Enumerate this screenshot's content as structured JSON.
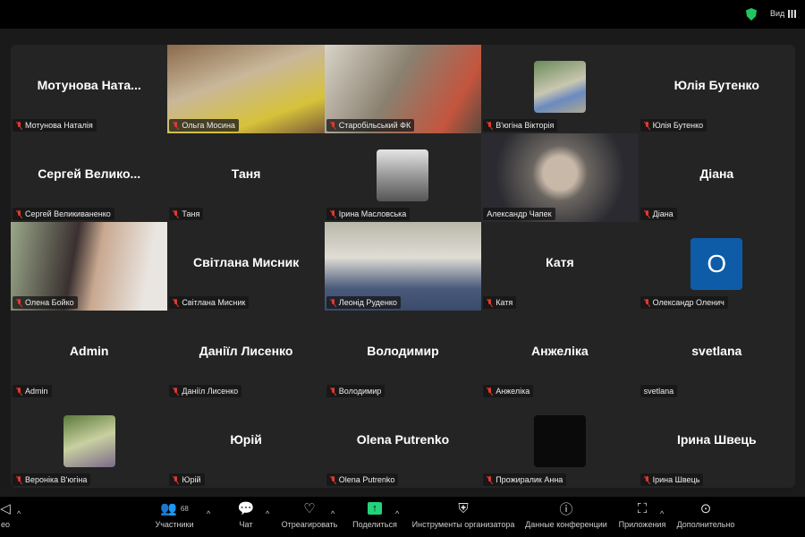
{
  "topbar": {
    "view_label": "Вид"
  },
  "tiles": [
    {
      "kind": "name",
      "big": "Мотунова  Ната...",
      "label": "Мотунова Наталія",
      "muted": true
    },
    {
      "kind": "video",
      "label": "Ольга Мосина",
      "muted": true,
      "bg": "linear-gradient(160deg,#8a6a4a,#c9b79a 40%,#d6c23a 75%,#7a5a3a)"
    },
    {
      "kind": "video",
      "label": "Старобільський ФК",
      "muted": true,
      "bg": "linear-gradient(120deg,#d9d4c8,#8a8070 45%,#c4553e 80%,#5a4a40)"
    },
    {
      "kind": "avatar",
      "label": "В'югіна Вікторія",
      "muted": true,
      "bg": "linear-gradient(160deg,#6a8a5a,#c9c7b0 50%,#6b8ac0 70%,#b0a890)"
    },
    {
      "kind": "name",
      "big": "Юлія Бутенко",
      "label": "Юлія Бутенко",
      "muted": true
    },
    {
      "kind": "name",
      "big": "Сергей  Велико...",
      "label": "Сергей Великиваненко",
      "muted": true
    },
    {
      "kind": "name",
      "big": "Таня",
      "label": "Таня",
      "muted": true
    },
    {
      "kind": "avatar",
      "label": "Ірина Масловська",
      "muted": true,
      "bg": "linear-gradient(180deg,#e5e5e5,#999 50%,#555)"
    },
    {
      "kind": "video",
      "label": "Александр Чапек",
      "muted": false,
      "active": true,
      "bg": "radial-gradient(circle at 50% 45%,#c8b8a8 0 18%,#6a6560 30%,#2a2a30 70%)"
    },
    {
      "kind": "name",
      "big": "Діана",
      "label": "Діана",
      "muted": true
    },
    {
      "kind": "video",
      "label": "Олена Бойко",
      "muted": true,
      "bg": "linear-gradient(100deg,#9aa88a,#3a3030 40%,#c9a890 55%,#e9e5e0 85%)"
    },
    {
      "kind": "name",
      "big": "Світлана Мисник",
      "label": "Світлана Мисник",
      "muted": true
    },
    {
      "kind": "video",
      "label": "Леонід Руденко",
      "muted": true,
      "bg": "linear-gradient(180deg,#b8b8a8,#e0ddd5 40%,#4a5a7a 75%,#3a4a6a)"
    },
    {
      "kind": "name",
      "big": "Катя",
      "label": "Катя",
      "muted": true
    },
    {
      "kind": "letter",
      "letter": "O",
      "label": "Олександр Оленич",
      "muted": true
    },
    {
      "kind": "name",
      "big": "Admin",
      "label": "Admin",
      "muted": true
    },
    {
      "kind": "name",
      "big": "Даніїл Лисенко",
      "label": "Даніїл Лисенко",
      "muted": true
    },
    {
      "kind": "name",
      "big": "Володимир",
      "label": "Володимир",
      "muted": true
    },
    {
      "kind": "name",
      "big": "Анжеліка",
      "label": "Анжеліка",
      "muted": true
    },
    {
      "kind": "name",
      "big": "svetlana",
      "label": "svetlana",
      "muted": false
    },
    {
      "kind": "avatar",
      "label": "Вероніка В'югіна",
      "muted": true,
      "bg": "linear-gradient(160deg,#5a7a3a,#c9d0a0 50%,#7a6a8a)"
    },
    {
      "kind": "name",
      "big": "Юрій",
      "label": "Юрій",
      "muted": true
    },
    {
      "kind": "name",
      "big": "Olena Putrenko",
      "label": "Olena Putrenko",
      "muted": true
    },
    {
      "kind": "avatar",
      "label": "Прожиралик Анна",
      "muted": true,
      "bg": "#0a0a0a"
    },
    {
      "kind": "name",
      "big": "Ірина Швець",
      "label": "Ірина Швець",
      "muted": true
    }
  ],
  "toolbar": {
    "video": "ео",
    "participants": "Участники",
    "participants_count": "68",
    "chat": "Чат",
    "react": "Отреагировать",
    "share": "Поделиться",
    "host_tools": "Инструменты организатора",
    "meeting_info": "Данные конференции",
    "apps": "Приложения",
    "more": "Дополнительно"
  }
}
